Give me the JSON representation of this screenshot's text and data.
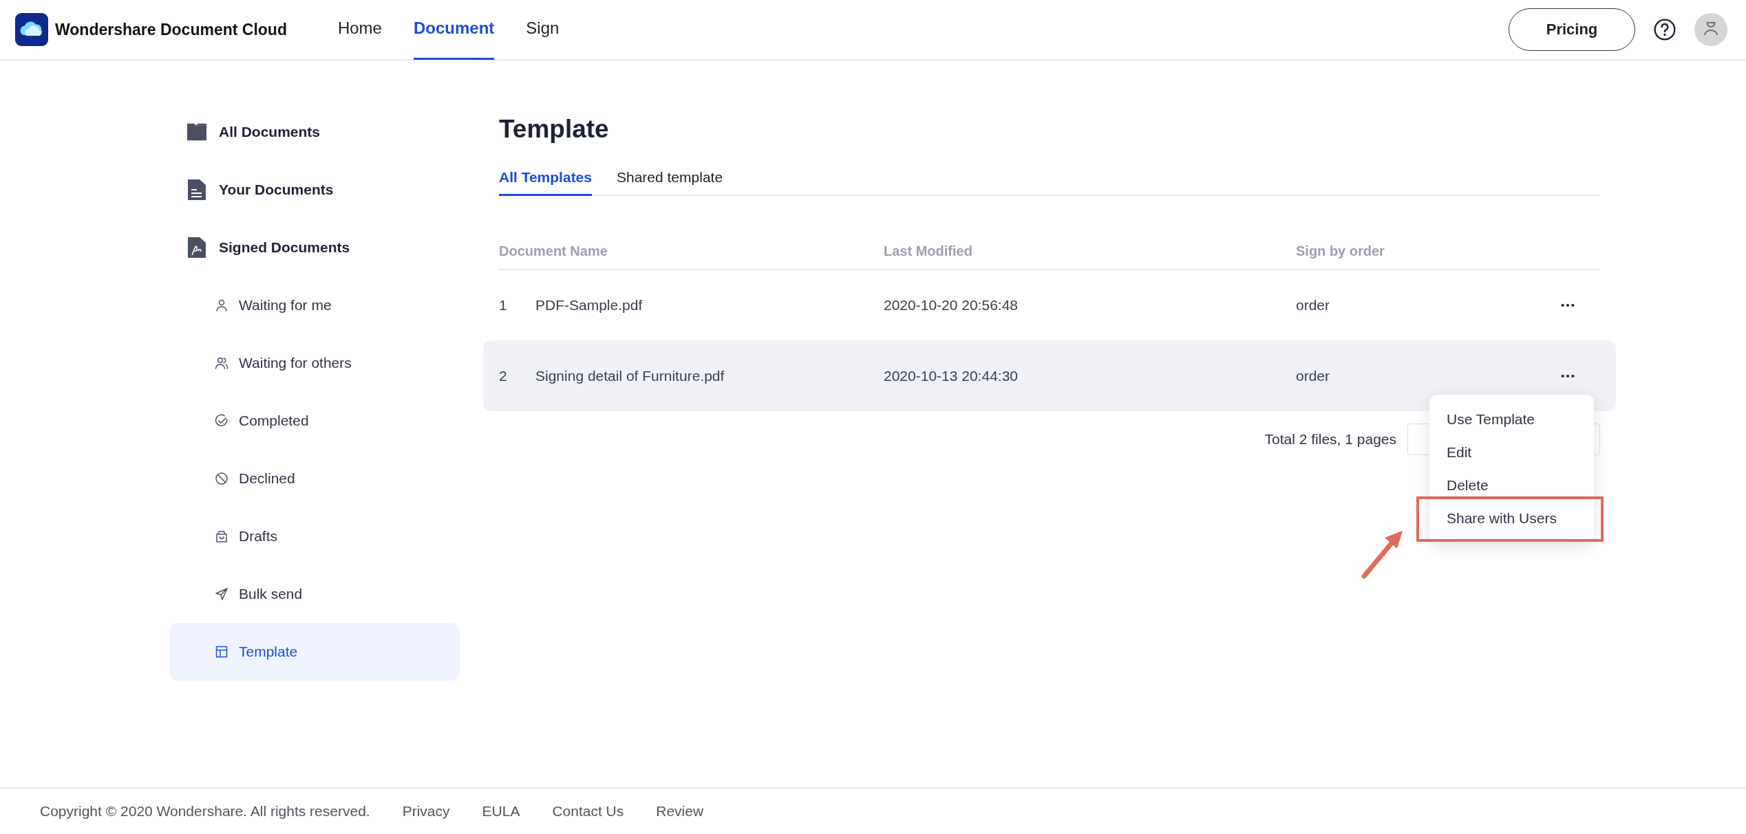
{
  "header": {
    "brand": "Wondershare Document Cloud",
    "nav": [
      {
        "label": "Home",
        "selected": false
      },
      {
        "label": "Document",
        "selected": true
      },
      {
        "label": "Sign",
        "selected": false
      }
    ],
    "pricing": "Pricing"
  },
  "sidebar": {
    "items": [
      {
        "label": "All Documents",
        "selected": false
      },
      {
        "label": "Your Documents",
        "selected": false
      },
      {
        "label": "Signed Documents",
        "selected": false,
        "children": [
          {
            "label": "Waiting for me",
            "selected": false
          },
          {
            "label": "Waiting for others",
            "selected": false
          },
          {
            "label": "Completed",
            "selected": false
          },
          {
            "label": "Declined",
            "selected": false
          },
          {
            "label": "Drafts",
            "selected": false
          },
          {
            "label": "Bulk send",
            "selected": false
          },
          {
            "label": "Template",
            "selected": true
          }
        ]
      }
    ]
  },
  "page": {
    "title": "Template",
    "tabs": [
      {
        "label": "All Templates",
        "selected": true
      },
      {
        "label": "Shared template",
        "selected": false
      }
    ],
    "table": {
      "columns": [
        "Document Name",
        "Last Modified",
        "Sign by order"
      ],
      "rows": [
        {
          "number": "1",
          "name": "PDF-Sample.pdf",
          "modified": "2020-10-20 20:56:48",
          "sign": "order",
          "hovered": false,
          "menu_open": false
        },
        {
          "number": "2",
          "name": "Signing detail of Furniture.pdf",
          "modified": "2020-10-13 20:44:30",
          "sign": "order",
          "hovered": true,
          "menu_open": true
        }
      ]
    },
    "pagination": {
      "summary": "Total 2 files, 1 pages"
    },
    "context_menu": {
      "items": [
        {
          "label": "Use Template",
          "annotated": false
        },
        {
          "label": "Edit",
          "annotated": false
        },
        {
          "label": "Delete",
          "annotated": false
        },
        {
          "label": "Share with Users",
          "annotated": true
        }
      ]
    }
  },
  "footer": {
    "copyright": "Copyright © 2020 Wondershare. All rights reserved.",
    "links": [
      "Privacy",
      "EULA",
      "Contact Us",
      "Review"
    ]
  }
}
